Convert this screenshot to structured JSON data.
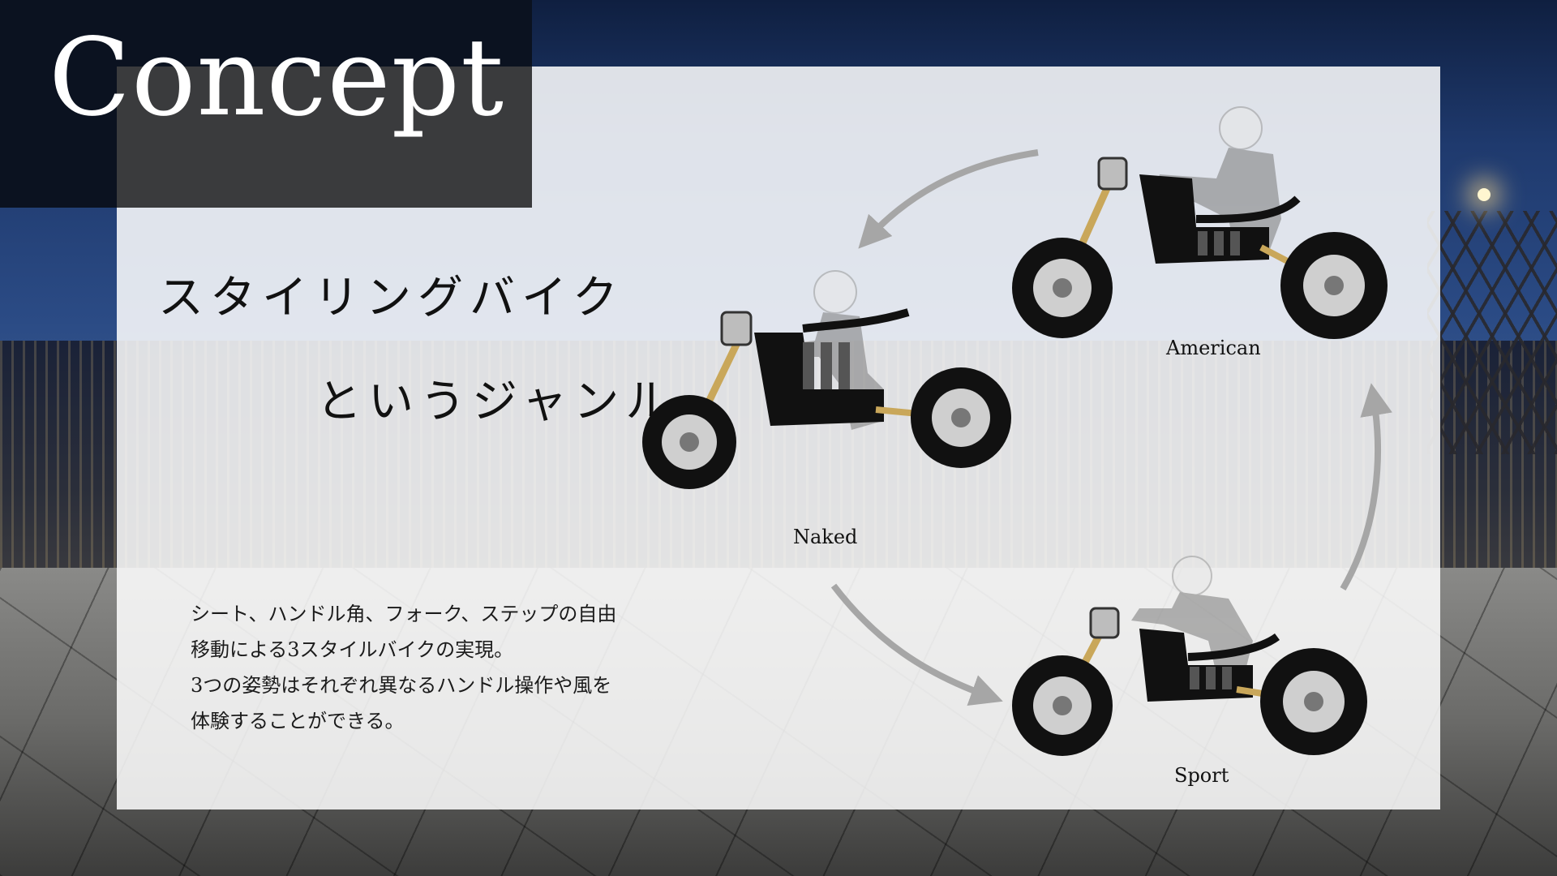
{
  "title": "Concept",
  "heading": {
    "line1": "スタイリングバイク",
    "line2": "というジャンル"
  },
  "description": [
    "シート、ハンドル角、フォーク、ステップの自由",
    "移動による3スタイルバイクの実現。",
    "3つの姿勢はそれぞれ異なるハンドル操作や風を",
    "体験することができる。"
  ],
  "styles": [
    {
      "label": "Naked"
    },
    {
      "label": "American"
    },
    {
      "label": "Sport"
    }
  ],
  "colors": {
    "panel": "#ffffff",
    "title_dark": "#0b1220",
    "title_grey": "#3a3b3d",
    "arrow": "#9a9a9a",
    "fork": "#c9a75a",
    "bike_body": "#111111"
  }
}
